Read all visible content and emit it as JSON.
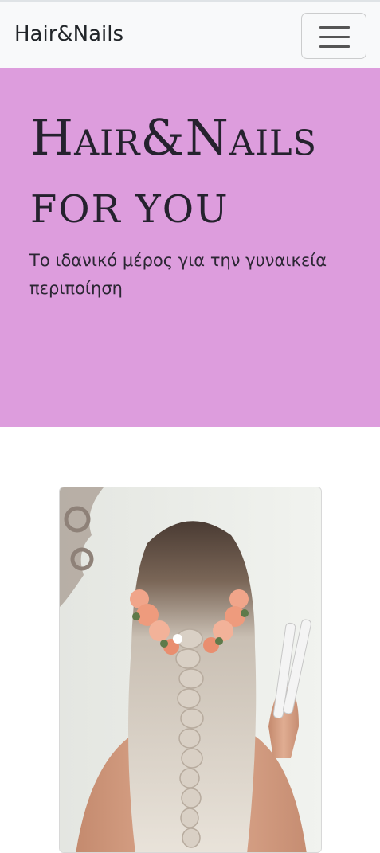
{
  "navbar": {
    "brand": "Hair&Nails",
    "toggler_icon": "hamburger-menu-icon"
  },
  "hero": {
    "title": "Hair&Nails",
    "subtitle": "FOR YOU",
    "lead": "Το ιδανικό μέρος για την γυναικεία περιποίηση",
    "background": "#dd9ddd"
  },
  "card": {
    "image_subject": "hairstyle-photo"
  }
}
